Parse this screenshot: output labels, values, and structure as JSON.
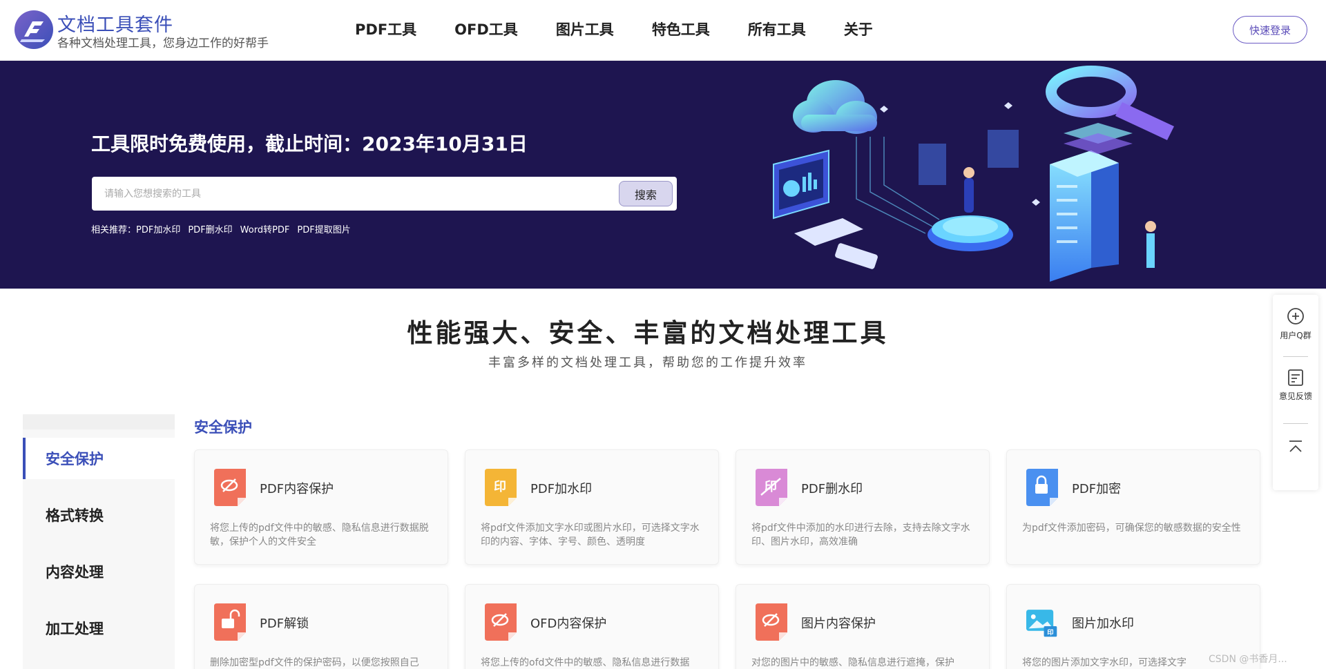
{
  "header": {
    "brand_title": "文档工具套件",
    "brand_subtitle": "各种文档处理工具，您身边工作的好帮手",
    "nav": [
      "PDF工具",
      "OFD工具",
      "图片工具",
      "特色工具",
      "所有工具",
      "关于"
    ],
    "login_label": "快速登录"
  },
  "banner": {
    "title": "工具限时免费使用，截止时间：2023年10月31日",
    "search_placeholder": "请输入您想搜索的工具",
    "search_value": "",
    "search_button": "搜索",
    "recommend_label": "相关推荐：",
    "recommend_links": [
      "PDF加水印",
      "PDF删水印",
      "Word转PDF",
      "PDF提取图片"
    ]
  },
  "float_panel": {
    "qq_group": "用户Q群",
    "feedback": "意见反馈"
  },
  "section": {
    "title": "性能强大、安全、丰富的文档处理工具",
    "subtitle": "丰富多样的文档处理工具，帮助您的工作提升效率"
  },
  "left_menu": [
    "安全保护",
    "格式转换",
    "内容处理",
    "加工处理"
  ],
  "category_title": "安全保护",
  "cards": [
    {
      "name": "PDF内容保护",
      "desc": "将您上传的pdf文件中的敏感、隐私信息进行数据脱敏，保护个人的文件安全",
      "icon": "eye-off-icon",
      "color": "#f0705a"
    },
    {
      "name": "PDF加水印",
      "desc": "将pdf文件添加文字水印或图片水印，可选择文字水印的内容、字体、字号、颜色、透明度",
      "icon": "watermark-icon",
      "color": "#f4b536"
    },
    {
      "name": "PDF删水印",
      "desc": "将pdf文件中添加的水印进行去除，支持去除文字水印、图片水印，高效准确",
      "icon": "remove-watermark-icon",
      "color": "#d98ad6"
    },
    {
      "name": "PDF加密",
      "desc": "为pdf文件添加密码，可确保您的敏感数据的安全性",
      "icon": "lock-icon",
      "color": "#4a90f0"
    },
    {
      "name": "PDF解锁",
      "desc": "删除加密型pdf文件的保护密码，以便您按照自己",
      "icon": "unlock-icon",
      "color": "#f0705a"
    },
    {
      "name": "OFD内容保护",
      "desc": "将您上传的ofd文件中的敏感、隐私信息进行数据",
      "icon": "eye-off-icon",
      "color": "#f0705a"
    },
    {
      "name": "图片内容保护",
      "desc": "对您的图片中的敏感、隐私信息进行遮掩，保护",
      "icon": "eye-off-icon",
      "color": "#f0705a"
    },
    {
      "name": "图片加水印",
      "desc": "将您的图片添加文字水印，可选择文字",
      "icon": "image-watermark-icon",
      "color": "#38b8e8"
    }
  ],
  "watermark_text": "CSDN @书香月..."
}
